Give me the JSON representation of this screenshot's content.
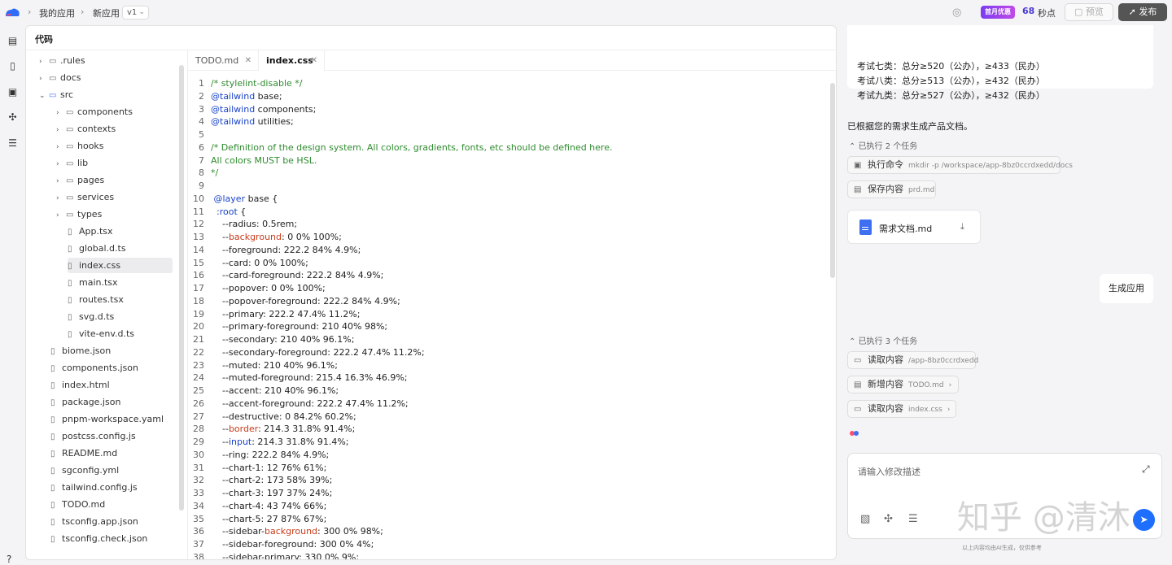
{
  "topbar": {
    "breadcrumb": [
      "我的应用",
      "新应用"
    ],
    "version": "v1",
    "promo": "首月优惠",
    "countdown_value": "68",
    "countdown_unit": "秒点",
    "preview_label": "预览",
    "publish_label": "发布"
  },
  "panel": {
    "title": "代码"
  },
  "tree": {
    "items": [
      {
        "label": ".rules",
        "type": "folder",
        "depth": 1,
        "expanded": false
      },
      {
        "label": "docs",
        "type": "folder",
        "depth": 1,
        "expanded": false
      },
      {
        "label": "src",
        "type": "folder",
        "depth": 1,
        "expanded": true
      },
      {
        "label": "components",
        "type": "folder",
        "depth": 2,
        "expanded": false
      },
      {
        "label": "contexts",
        "type": "folder",
        "depth": 2,
        "expanded": false
      },
      {
        "label": "hooks",
        "type": "folder",
        "depth": 2,
        "expanded": false
      },
      {
        "label": "lib",
        "type": "folder",
        "depth": 2,
        "expanded": false
      },
      {
        "label": "pages",
        "type": "folder",
        "depth": 2,
        "expanded": false
      },
      {
        "label": "services",
        "type": "folder",
        "depth": 2,
        "expanded": false
      },
      {
        "label": "types",
        "type": "folder",
        "depth": 2,
        "expanded": false
      },
      {
        "label": "App.tsx",
        "type": "file",
        "depth": 2
      },
      {
        "label": "global.d.ts",
        "type": "file",
        "depth": 2
      },
      {
        "label": "index.css",
        "type": "file",
        "depth": 2,
        "selected": true
      },
      {
        "label": "main.tsx",
        "type": "file",
        "depth": 2
      },
      {
        "label": "routes.tsx",
        "type": "file",
        "depth": 2
      },
      {
        "label": "svg.d.ts",
        "type": "file",
        "depth": 2
      },
      {
        "label": "vite-env.d.ts",
        "type": "file",
        "depth": 2
      },
      {
        "label": "biome.json",
        "type": "file",
        "depth": 1
      },
      {
        "label": "components.json",
        "type": "file",
        "depth": 1
      },
      {
        "label": "index.html",
        "type": "file",
        "depth": 1
      },
      {
        "label": "package.json",
        "type": "file",
        "depth": 1
      },
      {
        "label": "pnpm-workspace.yaml",
        "type": "file",
        "depth": 1
      },
      {
        "label": "postcss.config.js",
        "type": "file",
        "depth": 1
      },
      {
        "label": "README.md",
        "type": "file",
        "depth": 1
      },
      {
        "label": "sgconfig.yml",
        "type": "file",
        "depth": 1
      },
      {
        "label": "tailwind.config.js",
        "type": "file",
        "depth": 1
      },
      {
        "label": "TODO.md",
        "type": "file",
        "depth": 1
      },
      {
        "label": "tsconfig.app.json",
        "type": "file",
        "depth": 1
      },
      {
        "label": "tsconfig.check.json",
        "type": "file",
        "depth": 1
      }
    ]
  },
  "tabs": [
    {
      "label": "TODO.md",
      "active": false
    },
    {
      "label": "index.css",
      "active": true
    }
  ],
  "code_lines": [
    [
      [
        "/* stylelint-disable */",
        "cm"
      ]
    ],
    [
      [
        "@tailwind",
        "kw"
      ],
      [
        " base;",
        ""
      ]
    ],
    [
      [
        "@tailwind",
        "kw"
      ],
      [
        " components;",
        ""
      ]
    ],
    [
      [
        "@tailwind",
        "kw"
      ],
      [
        " utilities;",
        ""
      ]
    ],
    [],
    [
      [
        "/* Definition of the design system. All colors, gradients, fonts, etc should be defined here.",
        "cm"
      ]
    ],
    [
      [
        "All colors MUST be HSL.",
        "cm"
      ]
    ],
    [
      [
        "*/",
        "cm"
      ]
    ],
    [],
    [
      [
        " @layer",
        "kw"
      ],
      [
        " base {",
        ""
      ]
    ],
    [
      [
        "  :root",
        "kw"
      ],
      [
        " {",
        ""
      ]
    ],
    [
      [
        "    --radius: 0.5rem;",
        ""
      ]
    ],
    [
      [
        "    --",
        ""
      ],
      [
        "background",
        "vr"
      ],
      [
        ": 0 0% 100%;",
        ""
      ]
    ],
    [
      [
        "    --foreground: 222.2 84% 4.9%;",
        ""
      ]
    ],
    [
      [
        "    --card: 0 0% 100%;",
        ""
      ]
    ],
    [
      [
        "    --card-foreground: 222.2 84% 4.9%;",
        ""
      ]
    ],
    [
      [
        "    --popover: 0 0% 100%;",
        ""
      ]
    ],
    [
      [
        "    --popover-foreground: 222.2 84% 4.9%;",
        ""
      ]
    ],
    [
      [
        "    --primary: 222.2 47.4% 11.2%;",
        ""
      ]
    ],
    [
      [
        "    --primary-foreground: 210 40% 98%;",
        ""
      ]
    ],
    [
      [
        "    --secondary: 210 40% 96.1%;",
        ""
      ]
    ],
    [
      [
        "    --secondary-foreground: 222.2 47.4% 11.2%;",
        ""
      ]
    ],
    [
      [
        "    --muted: 210 40% 96.1%;",
        ""
      ]
    ],
    [
      [
        "    --muted-foreground: 215.4 16.3% 46.9%;",
        ""
      ]
    ],
    [
      [
        "    --accent: 210 40% 96.1%;",
        ""
      ]
    ],
    [
      [
        "    --accent-foreground: 222.2 47.4% 11.2%;",
        ""
      ]
    ],
    [
      [
        "    --destructive: 0 84.2% 60.2%;",
        ""
      ]
    ],
    [
      [
        "    --",
        ""
      ],
      [
        "border",
        "vr"
      ],
      [
        ": 214.3 31.8% 91.4%;",
        ""
      ]
    ],
    [
      [
        "    --",
        ""
      ],
      [
        "input",
        "kw"
      ],
      [
        ": 214.3 31.8% 91.4%;",
        ""
      ]
    ],
    [
      [
        "    --ring: 222.2 84% 4.9%;",
        ""
      ]
    ],
    [
      [
        "    --chart-1: 12 76% 61%;",
        ""
      ]
    ],
    [
      [
        "    --chart-2: 173 58% 39%;",
        ""
      ]
    ],
    [
      [
        "    --chart-3: 197 37% 24%;",
        ""
      ]
    ],
    [
      [
        "    --chart-4: 43 74% 66%;",
        ""
      ]
    ],
    [
      [
        "    --chart-5: 27 87% 67%;",
        ""
      ]
    ],
    [
      [
        "    --sidebar-",
        ""
      ],
      [
        "background",
        "vr"
      ],
      [
        ": 300 0% 98%;",
        ""
      ]
    ],
    [
      [
        "    --sidebar-foreground: 300 0% 4%;",
        ""
      ]
    ],
    [
      [
        "    --sidebar-primary: 330 0% 9%;",
        ""
      ]
    ]
  ],
  "chat": {
    "exam_lines": [
      "考试七类：总分≥520（公办），≥433（民办）",
      "考试八类：总分≥513（公办），≥432（民办）",
      "考试九类：总分≥527（公办），≥432（民办）"
    ],
    "doc_message": "已根据您的需求生成产品文档。",
    "tasks_1_header": "已执行 2 个任务",
    "tasks_1": [
      {
        "label": "执行命令",
        "sub": "mkdir -p /workspace/app-8bz0ccrdxedd/docs"
      },
      {
        "label": "保存内容",
        "sub": "prd.md"
      }
    ],
    "file_name": "需求文档.md",
    "user_message": "生成应用",
    "tasks_2_header": "已执行 3 个任务",
    "tasks_2": [
      {
        "label": "读取内容",
        "sub": "/app-8bz0ccrdxedd"
      },
      {
        "label": "新增内容",
        "sub": "TODO.md"
      },
      {
        "label": "读取内容",
        "sub": "index.css"
      }
    ],
    "input_placeholder": "请输入修改描述",
    "watermark": "知乎 @清沐",
    "disclaimer": "以上内容均由AI生成，仅供参考"
  },
  "colors": {
    "accent": "#1f6fff",
    "comment": "#2e8b2e",
    "keyword": "#1a44c8",
    "variable": "#c83a1a"
  }
}
